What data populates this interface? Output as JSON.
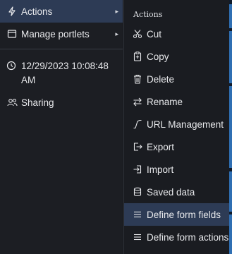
{
  "left_panel": {
    "actions_label": "Actions",
    "manage_portlets_label": "Manage portlets",
    "datetime": "12/29/2023 10:08:48 AM",
    "sharing_label": "Sharing"
  },
  "actions_menu": {
    "heading": "Actions",
    "items": [
      {
        "label": "Cut",
        "icon": "scissors-icon"
      },
      {
        "label": "Copy",
        "icon": "copy-icon"
      },
      {
        "label": "Delete",
        "icon": "trash-icon"
      },
      {
        "label": "Rename",
        "icon": "rename-arrows-icon"
      },
      {
        "label": "URL Management",
        "icon": "url-icon"
      },
      {
        "label": "Export",
        "icon": "export-icon"
      },
      {
        "label": "Import",
        "icon": "import-icon"
      },
      {
        "label": "Saved data",
        "icon": "database-icon"
      },
      {
        "label": "Define form fields",
        "icon": "list-icon"
      },
      {
        "label": "Define form actions",
        "icon": "list-icon"
      }
    ],
    "highlighted_item": "Define form fields"
  },
  "colors": {
    "background": "#191b20",
    "highlight": "#2d3b55",
    "text": "#e8e9ec",
    "accent_edge": "#2f6fb3"
  }
}
